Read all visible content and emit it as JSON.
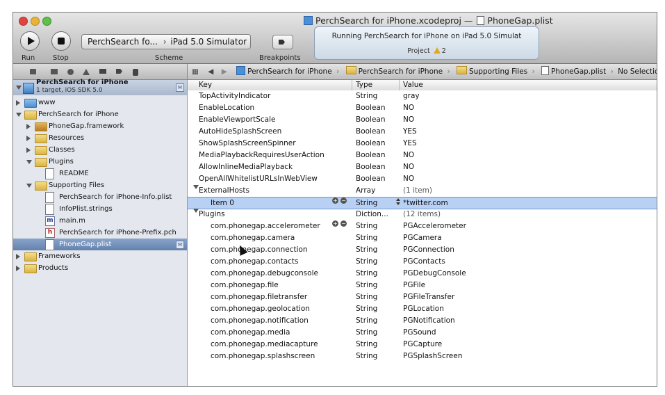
{
  "window": {
    "project_file": "PerchSearch for iPhone.xcodeproj",
    "separator": "—",
    "current_file": "PhoneGap.plist"
  },
  "toolbar": {
    "run_label": "Run",
    "stop_label": "Stop",
    "scheme_label": "Scheme",
    "breakpoints_label": "Breakpoints",
    "scheme_target": "PerchSearch fo...",
    "scheme_destination": "iPad 5.0 Simulator",
    "activity_message": "Running PerchSearch for iPhone on iPad 5.0 Simulat",
    "activity_project": "Project",
    "warning_count": "2"
  },
  "navigator": {
    "project_name": "PerchSearch for iPhone",
    "project_subtitle": "1 target, iOS SDK 5.0",
    "items": [
      {
        "label": "www",
        "type": "folder-blue",
        "indent": 1,
        "disclosure": "closed"
      },
      {
        "label": "PerchSearch for iPhone",
        "type": "folder",
        "indent": 1,
        "disclosure": "open"
      },
      {
        "label": "PhoneGap.framework",
        "type": "framework",
        "indent": 2,
        "disclosure": "closed"
      },
      {
        "label": "Resources",
        "type": "folder",
        "indent": 2,
        "disclosure": "closed"
      },
      {
        "label": "Classes",
        "type": "folder",
        "indent": 2,
        "disclosure": "closed"
      },
      {
        "label": "Plugins",
        "type": "folder",
        "indent": 2,
        "disclosure": "open"
      },
      {
        "label": "README",
        "type": "file",
        "indent": 3,
        "disclosure": "none"
      },
      {
        "label": "Supporting Files",
        "type": "folder",
        "indent": 2,
        "disclosure": "open"
      },
      {
        "label": "PerchSearch for iPhone-Info.plist",
        "type": "file",
        "indent": 3,
        "disclosure": "none"
      },
      {
        "label": "InfoPlist.strings",
        "type": "file",
        "indent": 3,
        "disclosure": "none"
      },
      {
        "label": "main.m",
        "type": "m",
        "indent": 3,
        "disclosure": "none"
      },
      {
        "label": "PerchSearch for iPhone-Prefix.pch",
        "type": "h",
        "indent": 3,
        "disclosure": "none"
      },
      {
        "label": "PhoneGap.plist",
        "type": "file",
        "indent": 3,
        "disclosure": "none",
        "selected": true,
        "badge": "M"
      },
      {
        "label": "Frameworks",
        "type": "folder",
        "indent": 1,
        "disclosure": "closed"
      },
      {
        "label": "Products",
        "type": "folder",
        "indent": 1,
        "disclosure": "closed"
      }
    ],
    "project_badge": "M"
  },
  "jumpbar": {
    "crumbs": [
      "PerchSearch for iPhone",
      "PerchSearch for iPhone",
      "Supporting Files",
      "PhoneGap.plist",
      "No Selection"
    ]
  },
  "plist": {
    "columns": [
      "Key",
      "Type",
      "Value"
    ],
    "rows": [
      {
        "key": "TopActivityIndicator",
        "type": "String",
        "value": "gray",
        "level": 0
      },
      {
        "key": "EnableLocation",
        "type": "Boolean",
        "value": "NO",
        "level": 0
      },
      {
        "key": "EnableViewportScale",
        "type": "Boolean",
        "value": "NO",
        "level": 0
      },
      {
        "key": "AutoHideSplashScreen",
        "type": "Boolean",
        "value": "YES",
        "level": 0
      },
      {
        "key": "ShowSplashScreenSpinner",
        "type": "Boolean",
        "value": "YES",
        "level": 0
      },
      {
        "key": "MediaPlaybackRequiresUserAction",
        "type": "Boolean",
        "value": "NO",
        "level": 0
      },
      {
        "key": "AllowInlineMediaPlayback",
        "type": "Boolean",
        "value": "NO",
        "level": 0
      },
      {
        "key": "OpenAllWhitelistURLsInWebView",
        "type": "Boolean",
        "value": "NO",
        "level": 0
      },
      {
        "key": "ExternalHosts",
        "type": "Array",
        "value": "(1 item)",
        "level": 0,
        "expanded": true
      },
      {
        "key": "Item 0",
        "type": "String",
        "value": "*twitter.com",
        "level": 1,
        "selected": true,
        "controls": true
      },
      {
        "key": "Plugins",
        "type": "Diction...",
        "value": "(12 items)",
        "level": 0,
        "expanded": true
      },
      {
        "key": "com.phonegap.accelerometer",
        "type": "String",
        "value": "PGAccelerometer",
        "level": 1,
        "controls": true
      },
      {
        "key": "com.phonegap.camera",
        "type": "String",
        "value": "PGCamera",
        "level": 1
      },
      {
        "key": "com.phonegap.connection",
        "type": "String",
        "value": "PGConnection",
        "level": 1
      },
      {
        "key": "com.phonegap.contacts",
        "type": "String",
        "value": "PGContacts",
        "level": 1
      },
      {
        "key": "com.phonegap.debugconsole",
        "type": "String",
        "value": "PGDebugConsole",
        "level": 1
      },
      {
        "key": "com.phonegap.file",
        "type": "String",
        "value": "PGFile",
        "level": 1
      },
      {
        "key": "com.phonegap.filetransfer",
        "type": "String",
        "value": "PGFileTransfer",
        "level": 1
      },
      {
        "key": "com.phonegap.geolocation",
        "type": "String",
        "value": "PGLocation",
        "level": 1
      },
      {
        "key": "com.phonegap.notification",
        "type": "String",
        "value": "PGNotification",
        "level": 1
      },
      {
        "key": "com.phonegap.media",
        "type": "String",
        "value": "PGSound",
        "level": 1
      },
      {
        "key": "com.phonegap.mediacapture",
        "type": "String",
        "value": "PGCapture",
        "level": 1
      },
      {
        "key": "com.phonegap.splashscreen",
        "type": "String",
        "value": "PGSplashScreen",
        "level": 1
      }
    ]
  },
  "colors": {
    "selection": "#b8d0f3",
    "nav_selection": "#6f8cb9",
    "warning": "#e0a81f"
  }
}
